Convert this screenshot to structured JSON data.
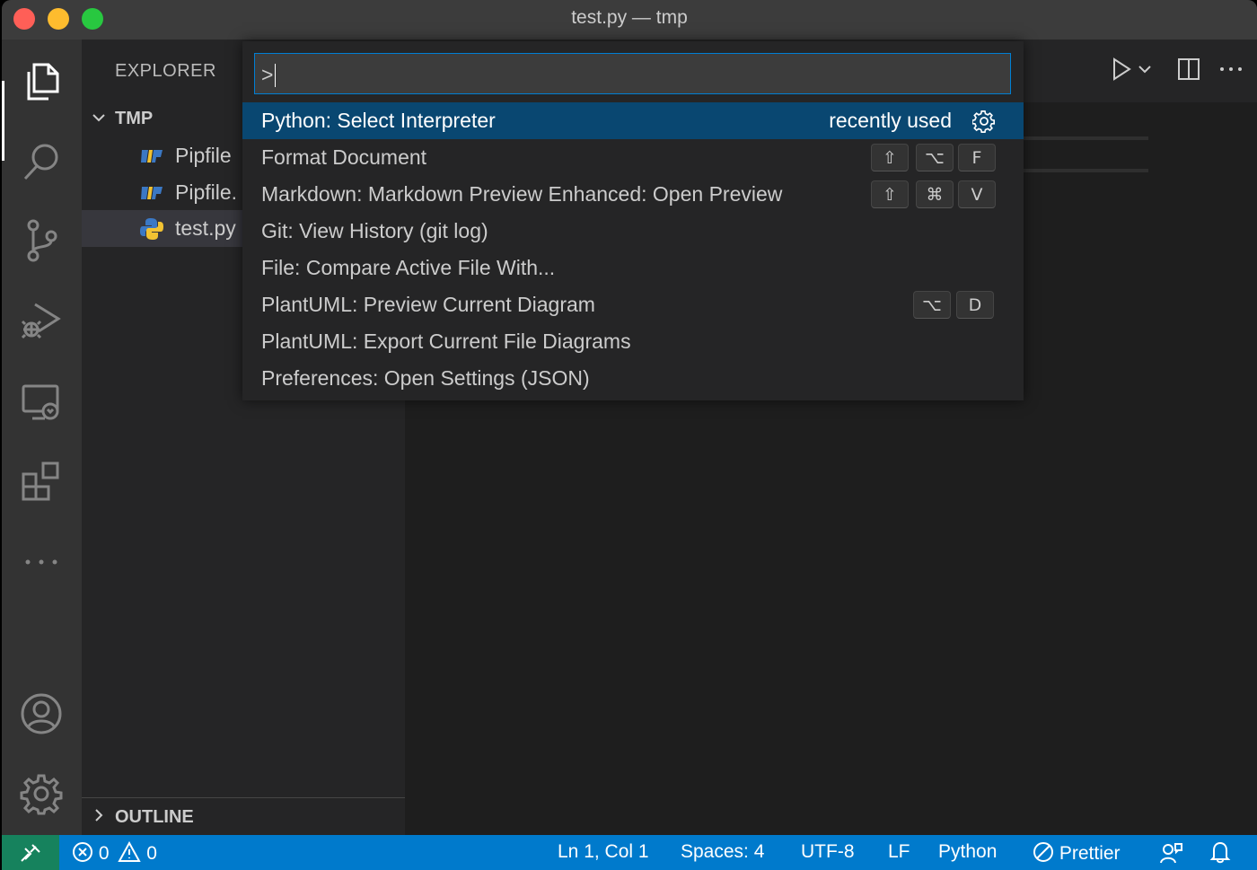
{
  "window": {
    "title": "test.py — tmp"
  },
  "activity_bar": {
    "items": [
      {
        "name": "explorer-icon"
      },
      {
        "name": "search-icon"
      },
      {
        "name": "source-control-icon"
      },
      {
        "name": "run-debug-icon"
      },
      {
        "name": "remote-explorer-icon"
      },
      {
        "name": "extensions-icon"
      },
      {
        "name": "more-icon"
      },
      {
        "name": "accounts-icon"
      },
      {
        "name": "manage-gear-icon"
      }
    ]
  },
  "sidebar": {
    "title": "EXPLORER",
    "folder": "TMP",
    "files": [
      {
        "label": "Pipfile",
        "icon": "pipfile-icon"
      },
      {
        "label": "Pipfile.",
        "icon": "pipfile-icon"
      },
      {
        "label": "test.py",
        "icon": "python-icon"
      }
    ],
    "outline": "OUTLINE"
  },
  "command_palette": {
    "input_value": ">",
    "items": [
      {
        "label": "Python: Select Interpreter",
        "meta": "recently used",
        "keys": []
      },
      {
        "label": "Format Document",
        "meta": "",
        "keys": [
          "⇧",
          "⌥",
          "F"
        ]
      },
      {
        "label": "Markdown: Markdown Preview Enhanced: Open Preview",
        "meta": "",
        "keys": [
          "⇧",
          "⌘",
          "V"
        ]
      },
      {
        "label": "Git: View History (git log)",
        "meta": "",
        "keys": []
      },
      {
        "label": "File: Compare Active File With...",
        "meta": "",
        "keys": []
      },
      {
        "label": "PlantUML: Preview Current Diagram",
        "meta": "",
        "keys": [
          "⌥",
          "D"
        ]
      },
      {
        "label": "PlantUML: Export Current File Diagrams",
        "meta": "",
        "keys": []
      },
      {
        "label": "Preferences: Open Settings (JSON)",
        "meta": "",
        "keys": []
      }
    ]
  },
  "status_bar": {
    "errors": "0",
    "warnings": "0",
    "position": "Ln 1, Col 1",
    "spaces": "Spaces: 4",
    "encoding": "UTF-8",
    "eol": "LF",
    "language": "Python",
    "formatter": "Prettier"
  },
  "colors": {
    "accent": "#007acc",
    "remote": "#16825d",
    "selection": "#094771",
    "focus_border": "#007fd4"
  }
}
